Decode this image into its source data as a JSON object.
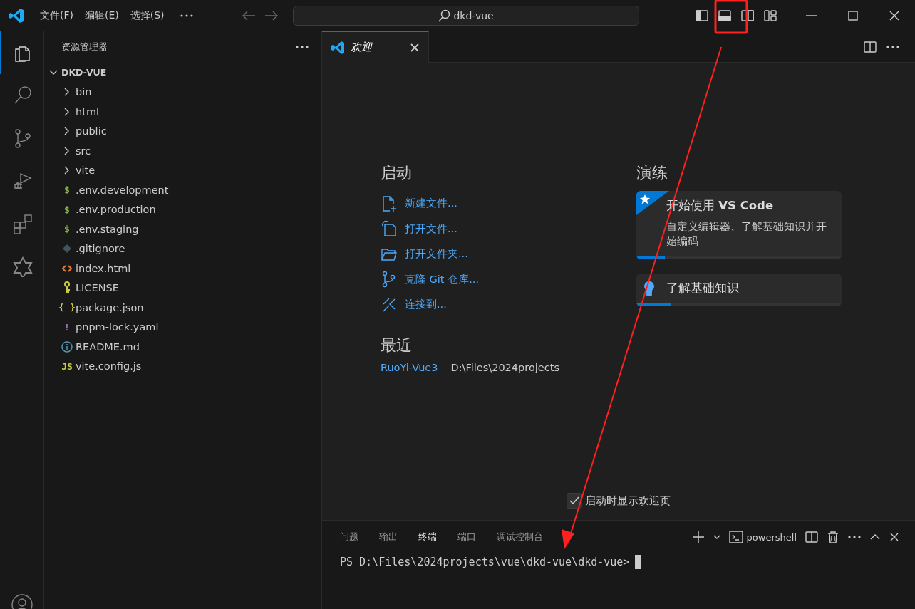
{
  "menu": [
    {
      "label": "文件(F)"
    },
    {
      "label": "编辑(E)"
    },
    {
      "label": "选择(S)"
    }
  ],
  "command_center": {
    "value": "dkd-vue"
  },
  "layout_toggles": [
    {
      "kind": "sidebar",
      "on": true
    },
    {
      "kind": "panel",
      "on": true
    },
    {
      "kind": "secondary",
      "on": false
    },
    {
      "kind": "customize"
    }
  ],
  "activity_bar": [
    {
      "kind": "explorer",
      "selected": true
    },
    {
      "kind": "search",
      "selected": false
    },
    {
      "kind": "scm",
      "selected": false
    },
    {
      "kind": "debug",
      "selected": false
    },
    {
      "kind": "extensions",
      "selected": false
    },
    {
      "kind": "remote",
      "selected": false
    }
  ],
  "explorer": {
    "title": "资源管理器",
    "root": {
      "label": "DKD-VUE",
      "expanded": true
    },
    "items": [
      {
        "kind": "folder",
        "label": "bin",
        "expanded": false
      },
      {
        "kind": "folder",
        "label": "html",
        "expanded": false
      },
      {
        "kind": "folder",
        "label": "public",
        "expanded": false
      },
      {
        "kind": "folder",
        "label": "src",
        "expanded": false
      },
      {
        "kind": "folder",
        "label": "vite",
        "expanded": false
      },
      {
        "kind": "file",
        "label": ".env.development",
        "icon": {
          "kind": "glyph",
          "text": "$",
          "color": "#8dc149"
        }
      },
      {
        "kind": "file",
        "label": ".env.production",
        "icon": {
          "kind": "glyph",
          "text": "$",
          "color": "#8dc149"
        }
      },
      {
        "kind": "file",
        "label": ".env.staging",
        "icon": {
          "kind": "glyph",
          "text": "$",
          "color": "#8dc149"
        }
      },
      {
        "kind": "file",
        "label": ".gitignore",
        "icon": {
          "kind": "diamond",
          "color": "#41535b"
        }
      },
      {
        "kind": "file",
        "label": "index.html",
        "icon": {
          "kind": "code",
          "color": "#e37933"
        }
      },
      {
        "kind": "file",
        "label": "LICENSE",
        "icon": {
          "kind": "key",
          "color": "#cbcb41"
        }
      },
      {
        "kind": "file",
        "label": "package.json",
        "icon": {
          "kind": "glyph",
          "text": "{ }",
          "color": "#cbcb41"
        }
      },
      {
        "kind": "file",
        "label": "pnpm-lock.yaml",
        "icon": {
          "kind": "glyph",
          "text": "!",
          "color": "#a074c4"
        }
      },
      {
        "kind": "file",
        "label": "README.md",
        "icon": {
          "kind": "info",
          "color": "#519aba"
        }
      },
      {
        "kind": "file",
        "label": "vite.config.js",
        "icon": {
          "kind": "glyph",
          "text": "JS",
          "color": "#cbcb41"
        }
      }
    ]
  },
  "editor_tabs": [
    {
      "label": "欢迎",
      "selected": true
    }
  ],
  "welcome": {
    "start": {
      "title": "启动",
      "items": [
        {
          "kind": "new-file",
          "label": "新建文件..."
        },
        {
          "kind": "open-file",
          "label": "打开文件..."
        },
        {
          "kind": "open-folder",
          "label": "打开文件夹..."
        },
        {
          "kind": "clone",
          "label": "克隆 Git 仓库..."
        },
        {
          "kind": "connect",
          "label": "连接到..."
        }
      ]
    },
    "recent": {
      "title": "最近",
      "items": [
        {
          "name": "RuoYi-Vue3",
          "path": "D:\\Files\\2024projects"
        }
      ]
    },
    "walkthroughs": {
      "title": "演练",
      "items": [
        {
          "kind": "featured",
          "title": "开始使用 **VS Code**",
          "description": "自定义编辑器、了解基础知识并开始编码",
          "level": 0.14
        },
        {
          "kind": "tip",
          "title": "了解基础知识",
          "level": 0.17
        }
      ]
    },
    "show_on_startup": {
      "label": "启动时显示欢迎页",
      "checked": true
    }
  },
  "panel": {
    "tabs": [
      {
        "label": "问题",
        "selected": false
      },
      {
        "label": "输出",
        "selected": false
      },
      {
        "label": "终端",
        "selected": true
      },
      {
        "label": "端口",
        "selected": false
      },
      {
        "label": "调试控制台",
        "selected": false
      }
    ],
    "terminal_profile": "powershell",
    "terminal_lines": [
      "PS D:\\Files\\2024projects\\vue\\dkd-vue\\dkd-vue>"
    ]
  }
}
